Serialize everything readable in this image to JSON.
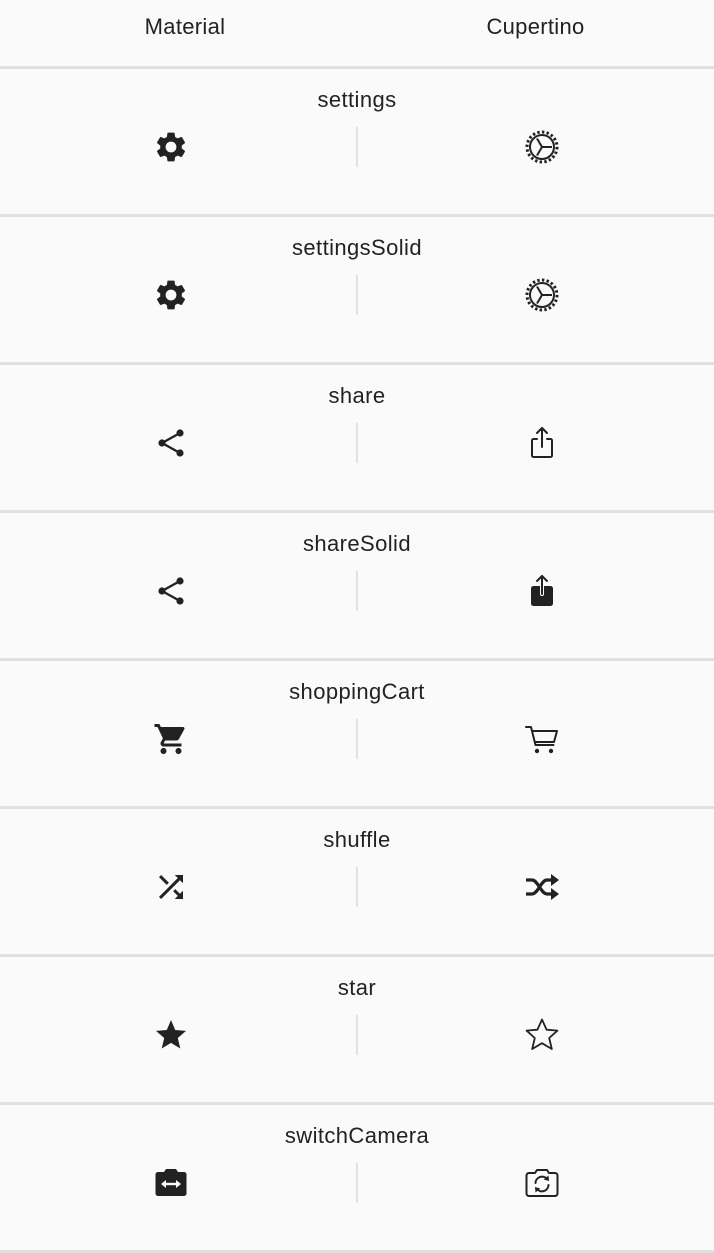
{
  "header": {
    "material_label": "Material",
    "cupertino_label": "Cupertino"
  },
  "rows": [
    {
      "label": "settings",
      "material_icon": "settings-gear-icon",
      "cupertino_icon": "settings-gear-outline-icon"
    },
    {
      "label": "settingsSolid",
      "material_icon": "settings-gear-icon",
      "cupertino_icon": "settings-gear-outline-icon"
    },
    {
      "label": "share",
      "material_icon": "share-nodes-icon",
      "cupertino_icon": "share-box-outline-icon"
    },
    {
      "label": "shareSolid",
      "material_icon": "share-nodes-icon",
      "cupertino_icon": "share-box-solid-icon"
    },
    {
      "label": "shoppingCart",
      "material_icon": "shopping-cart-solid-icon",
      "cupertino_icon": "shopping-cart-outline-icon"
    },
    {
      "label": "shuffle",
      "material_icon": "shuffle-icon",
      "cupertino_icon": "shuffle-bold-icon"
    },
    {
      "label": "star",
      "material_icon": "star-solid-icon",
      "cupertino_icon": "star-outline-icon"
    },
    {
      "label": "switchCamera",
      "material_icon": "switch-camera-solid-icon",
      "cupertino_icon": "switch-camera-outline-icon"
    }
  ],
  "colors": {
    "background": "#fafafa",
    "divider": "#e0e0e0",
    "icon": "#222222"
  }
}
